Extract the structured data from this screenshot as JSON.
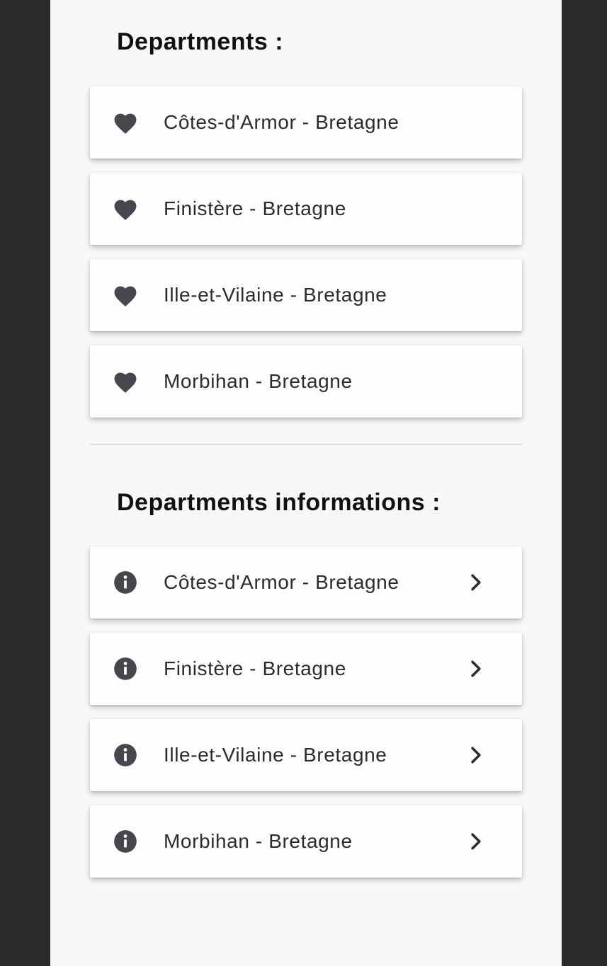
{
  "favorites": {
    "title": "Departments :",
    "items": [
      {
        "label": "Côtes-d'Armor - Bretagne",
        "icon": "heart-icon"
      },
      {
        "label": "Finistère - Bretagne",
        "icon": "heart-icon"
      },
      {
        "label": "Ille-et-Vilaine - Bretagne",
        "icon": "heart-icon"
      },
      {
        "label": "Morbihan - Bretagne",
        "icon": "heart-icon"
      }
    ]
  },
  "informations": {
    "title": "Departments informations :",
    "items": [
      {
        "label": "Côtes-d'Armor - Bretagne",
        "icon": "info-icon",
        "trailing_icon": "chevron-right-icon"
      },
      {
        "label": "Finistère - Bretagne",
        "icon": "info-icon",
        "trailing_icon": "chevron-right-icon"
      },
      {
        "label": "Ille-et-Vilaine - Bretagne",
        "icon": "info-icon",
        "trailing_icon": "chevron-right-icon"
      },
      {
        "label": "Morbihan - Bretagne",
        "icon": "info-icon",
        "trailing_icon": "chevron-right-icon"
      }
    ]
  },
  "colors": {
    "background": "#f7f8f7",
    "card": "#fffcfd",
    "text": "#2d2b30",
    "icon": "#48454e",
    "frame": "#2b292c"
  }
}
